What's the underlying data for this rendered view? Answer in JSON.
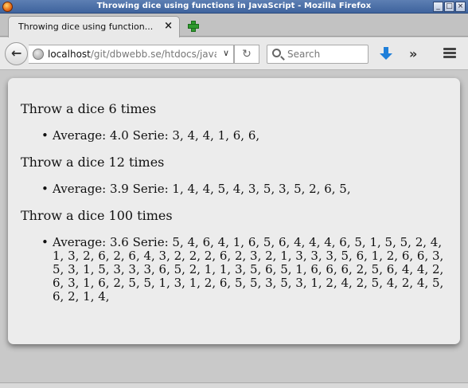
{
  "window": {
    "title": "Throwing dice using functions in JavaScript - Mozilla Firefox",
    "controls": [
      "_",
      "□",
      "×"
    ]
  },
  "tabs": [
    {
      "label": "Throwing dice using function...",
      "close": "×"
    }
  ],
  "toolbar": {
    "back": "←",
    "url_host": "localhost",
    "url_path": "/git/dbwebb.se/htdocs/javas",
    "url_dropdown": "∨",
    "reload": "↻",
    "search_placeholder": "Search",
    "overflow": "»"
  },
  "icons": {
    "site": "globe-icon",
    "search": "magnifier-icon",
    "download": "download-arrow-icon",
    "menu": "hamburger-icon",
    "newtab": "plus-icon"
  },
  "content": {
    "sections": [
      {
        "heading": "Throw a dice 6 times",
        "result": "Average: 4.0 Serie: 3, 4, 4, 1, 6, 6,"
      },
      {
        "heading": "Throw a dice 12 times",
        "result": "Average: 3.9 Serie: 1, 4, 4, 5, 4, 3, 5, 3, 5, 2, 6, 5,"
      },
      {
        "heading": "Throw a dice 100 times",
        "result": "Average: 3.6 Serie: 5, 4, 6, 4, 1, 6, 5, 6, 4, 4, 4, 6, 5, 1, 5, 5, 2, 4, 1, 3, 2, 6, 2, 6, 4, 3, 2, 2, 2, 6, 2, 3, 2, 1, 3, 3, 3, 5, 6, 1, 2, 6, 6, 3, 5, 3, 1, 5, 3, 3, 3, 6, 5, 2, 1, 1, 3, 5, 6, 5, 1, 6, 6, 6, 2, 5, 6, 4, 4, 2, 6, 3, 1, 6, 2, 5, 5, 1, 3, 1, 2, 6, 5, 5, 3, 5, 3, 1, 2, 4, 2, 5, 4, 2, 4, 5, 6, 2, 1, 4,"
      }
    ]
  }
}
